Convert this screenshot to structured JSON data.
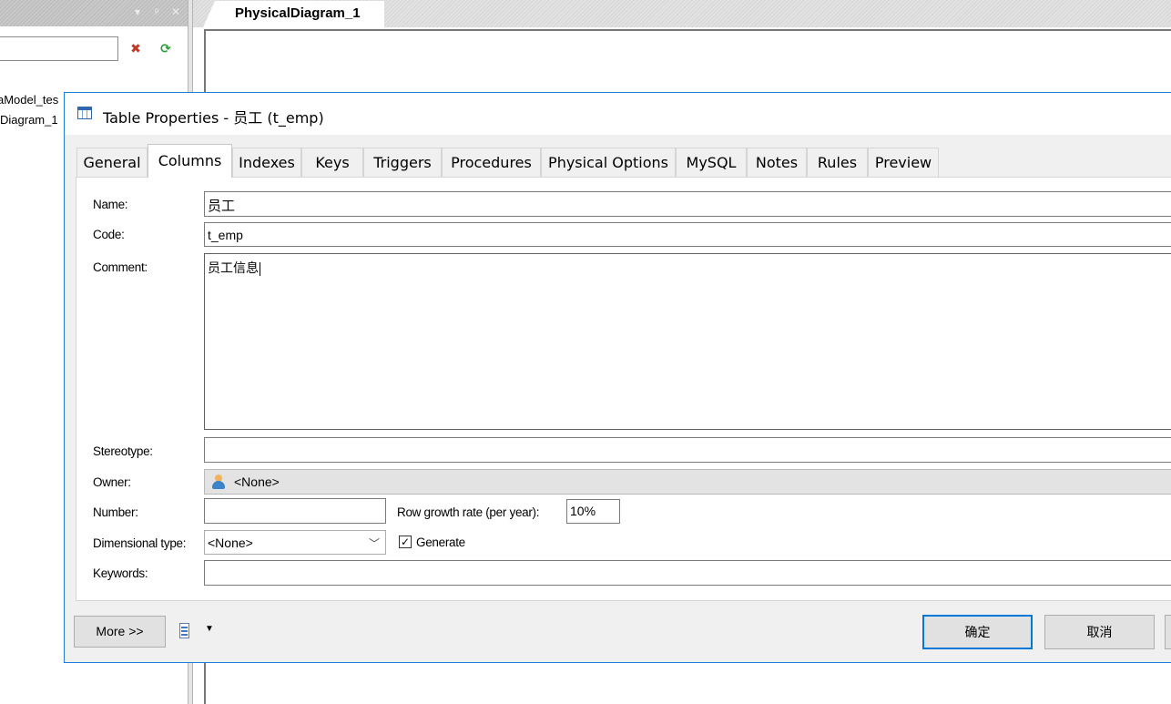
{
  "left_panel": {
    "header_controls": [
      "▾",
      "ᵖ",
      "✕"
    ],
    "tree_items": [
      "aModel_tes",
      "Diagram_1"
    ]
  },
  "document_tab": {
    "label": "PhysicalDiagram_1"
  },
  "dialog": {
    "title": "Table Properties - 员工 (t_emp)",
    "tabs": [
      "General",
      "Columns",
      "Indexes",
      "Keys",
      "Triggers",
      "Procedures",
      "Physical Options",
      "MySQL",
      "Notes",
      "Rules",
      "Preview"
    ],
    "active_tab": "Columns",
    "form": {
      "name_label": "Name:",
      "name_value": "员工",
      "code_label": "Code:",
      "code_value": "t_emp",
      "comment_label": "Comment:",
      "comment_value": "员工信息",
      "stereotype_label": "Stereotype:",
      "stereotype_value": "",
      "owner_label": "Owner:",
      "owner_value": "<None>",
      "number_label": "Number:",
      "number_value": "",
      "row_growth_label": "Row growth rate (per year):",
      "row_growth_value": "10%",
      "dimensional_label": "Dimensional type:",
      "dimensional_value": "<None>",
      "generate_label": "Generate",
      "generate_checked": true,
      "keywords_label": "Keywords:",
      "keywords_value": ""
    },
    "buttons": {
      "more": "More >>",
      "ok": "确定",
      "cancel": "取消"
    }
  },
  "colors": {
    "accent": "#0078d7",
    "dialog_border": "#1c7ed6"
  }
}
